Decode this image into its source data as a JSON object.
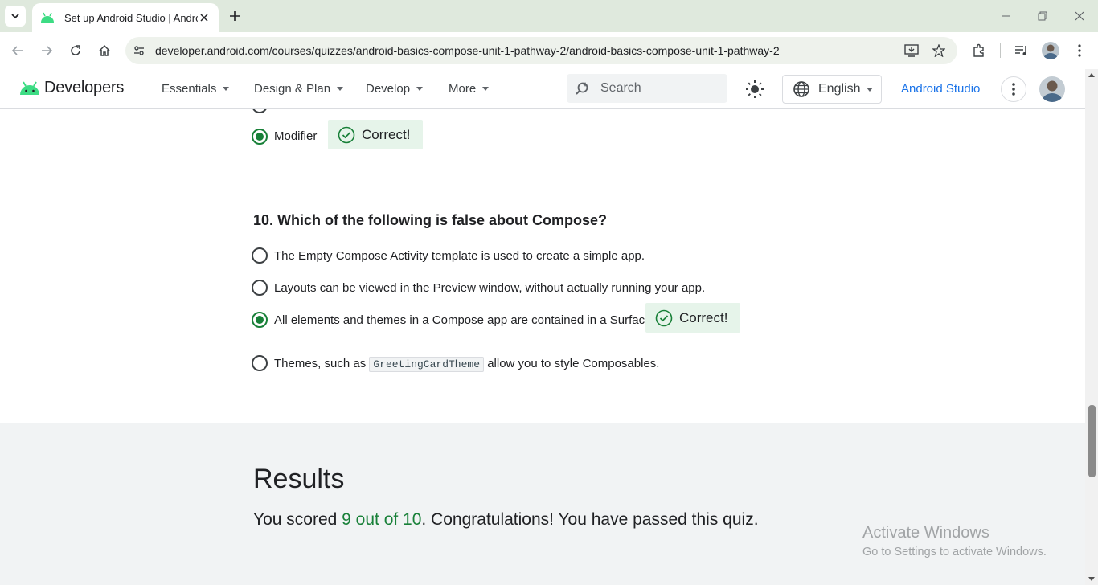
{
  "browser": {
    "tab_title": "Set up Android Studio  |  Andro",
    "url": "developer.android.com/courses/quizzes/android-basics-compose-unit-1-pathway-2/android-basics-compose-unit-1-pathway-2"
  },
  "header": {
    "brand": "Developers",
    "nav": [
      {
        "label": "Essentials"
      },
      {
        "label": "Design & Plan"
      },
      {
        "label": "Develop"
      },
      {
        "label": "More"
      }
    ],
    "search_placeholder": "Search",
    "language": "English",
    "studio_link": "Android Studio"
  },
  "quiz": {
    "prev_answer": {
      "label": "Modifier",
      "selected": true,
      "feedback": "Correct!"
    },
    "question": {
      "number": "10.",
      "text": "Which of the following is false about Compose?",
      "options": [
        {
          "text": "The Empty Compose Activity template is used to create a simple app.",
          "selected": false
        },
        {
          "text": "Layouts can be viewed in the Preview window, without actually running your app.",
          "selected": false
        },
        {
          "text": "All elements and themes in a Compose app are contained in a Surface.",
          "selected": true,
          "feedback": "Correct!"
        },
        {
          "prefix": "Themes, such as",
          "code": "GreetingCardTheme",
          "suffix": "allow you to style Composables.",
          "selected": false
        }
      ]
    }
  },
  "results": {
    "title": "Results",
    "prefix": "You scored",
    "score": "9 out of 10",
    "suffix": ". Congratulations! You have passed this quiz."
  },
  "watermark": {
    "title": "Activate Windows",
    "subtitle": "Go to Settings to activate Windows."
  },
  "colors": {
    "accent_green": "#188038",
    "link_blue": "#1a73e8",
    "android_green": "#3ddc84",
    "badge_bg": "#e6f4ea"
  }
}
